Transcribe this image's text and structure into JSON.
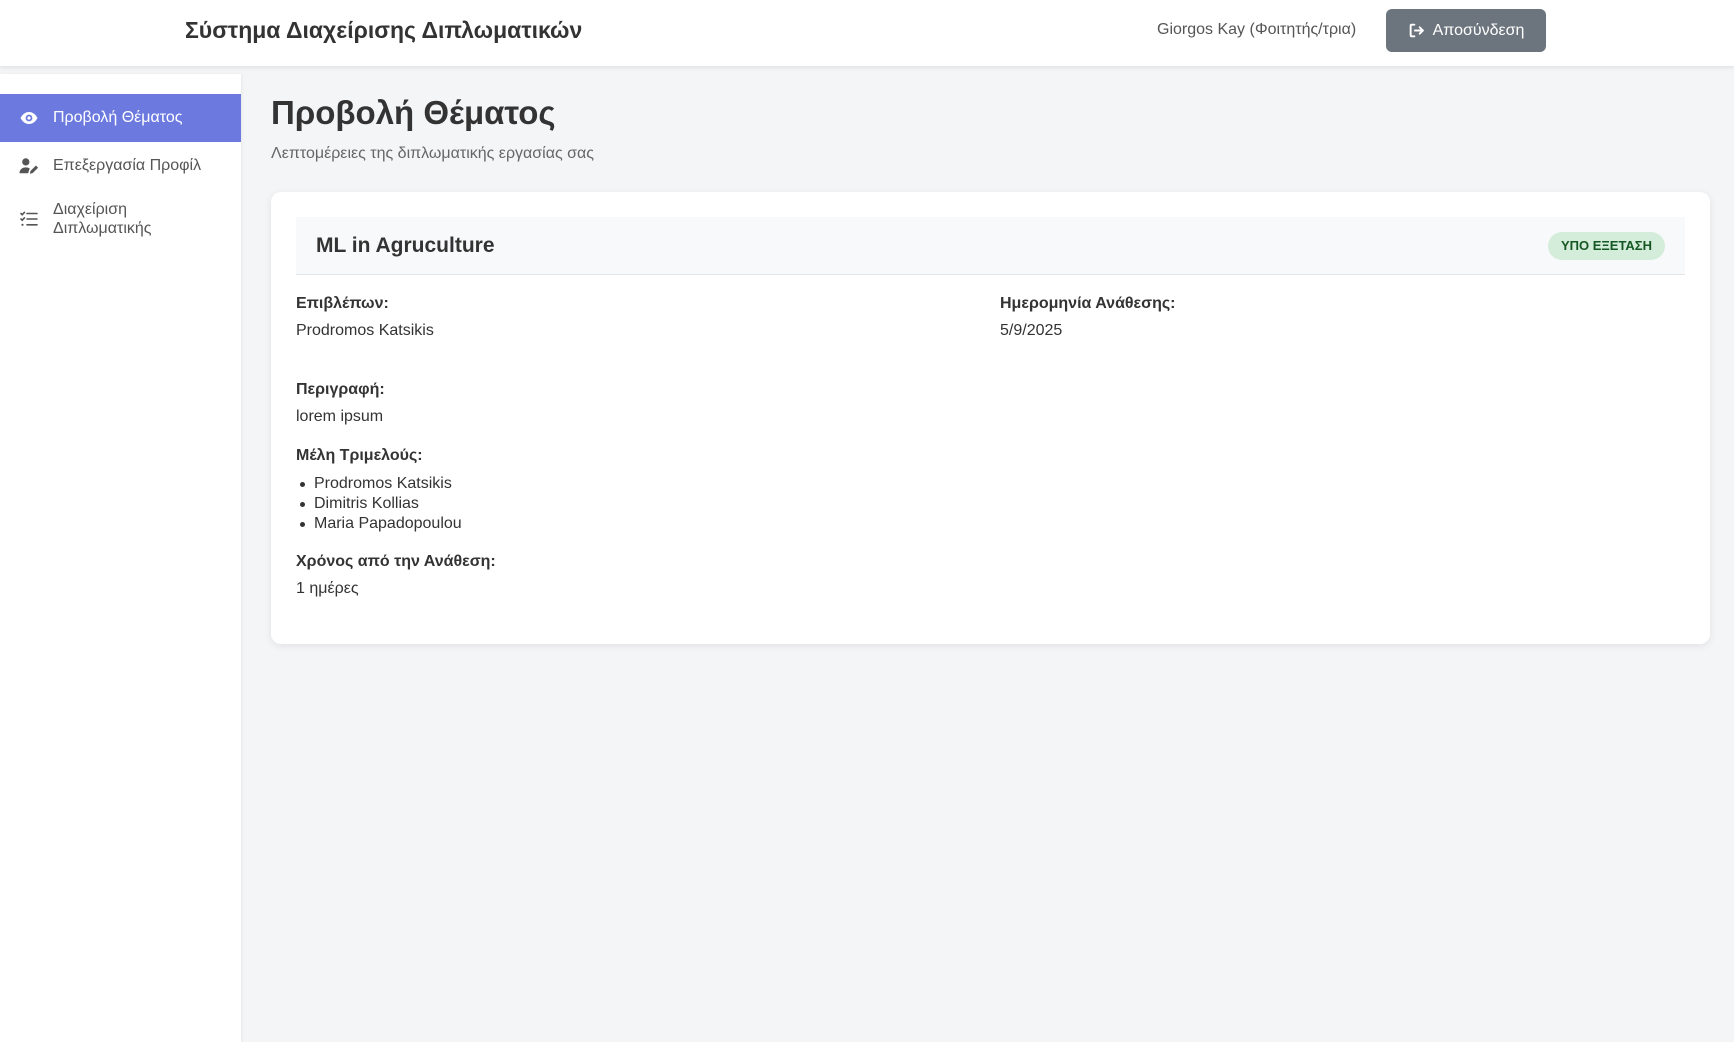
{
  "header": {
    "app_title": "Σύστημα Διαχείρισης Διπλωματικών",
    "user_name": "Giorgos Kay (Φοιτητής/τρια)",
    "logout_label": "Αποσύνδεση",
    "logout_icon": "sign-out-icon"
  },
  "sidebar": {
    "items": [
      {
        "label": "Προβολή Θέματος",
        "icon": "eye-icon",
        "active": true
      },
      {
        "label": "Επεξεργασία Προφίλ",
        "icon": "user-edit-icon",
        "active": false
      },
      {
        "label": "Διαχείριση Διπλωματικής",
        "icon": "tasks-list-icon",
        "active": false
      }
    ]
  },
  "page": {
    "title": "Προβολή Θέματος",
    "subtitle": "Λεπτομέρειες της διπλωματικής εργασίας σας"
  },
  "thesis": {
    "title": "ML in Agruculture",
    "status": "ΥΠΟ ΕΞΕΤΑΣΗ",
    "supervisor_label": "Επιβλέπων:",
    "supervisor": "Prodromos Katsikis",
    "assigned_date_label": "Ημερομηνία Ανάθεσης:",
    "assigned_date": "5/9/2025",
    "description_label": "Περιγραφή:",
    "description": "lorem ipsum",
    "committee_label": "Μέλη Τριμελούς:",
    "committee": [
      "Prodromos Katsikis",
      "Dimitris Kollias",
      "Maria Papadopoulou"
    ],
    "elapsed_label": "Χρόνος από την Ανάθεση:",
    "elapsed": "1 ημέρες"
  },
  "colors": {
    "accent": "#6c7ae0",
    "logout_button": "#6c757d",
    "badge_bg": "#d4edda",
    "badge_text": "#155724"
  }
}
